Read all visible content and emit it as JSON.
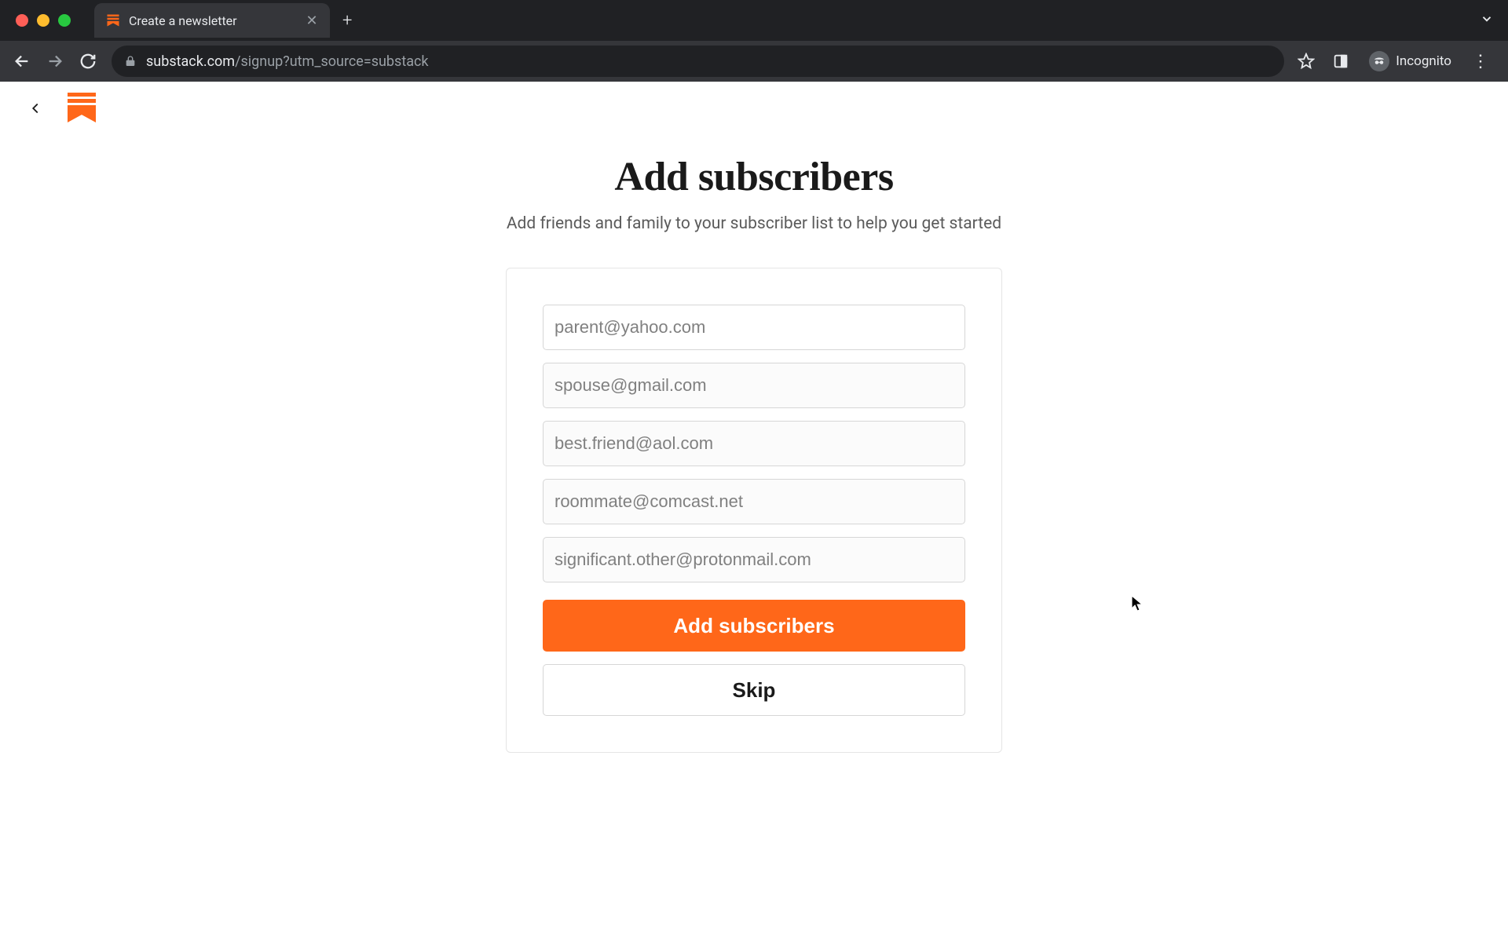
{
  "browser": {
    "tab_title": "Create a newsletter",
    "url_host": "substack.com",
    "url_path": "/signup?utm_source=substack",
    "incognito_label": "Incognito"
  },
  "page": {
    "title": "Add subscribers",
    "subtitle": "Add friends and family to your subscriber list to help you get started",
    "emails": [
      {
        "placeholder": "parent@yahoo.com"
      },
      {
        "placeholder": "spouse@gmail.com"
      },
      {
        "placeholder": "best.friend@aol.com"
      },
      {
        "placeholder": "roommate@comcast.net"
      },
      {
        "placeholder": "significant.other@protonmail.com"
      }
    ],
    "primary_button": "Add subscribers",
    "secondary_button": "Skip"
  }
}
